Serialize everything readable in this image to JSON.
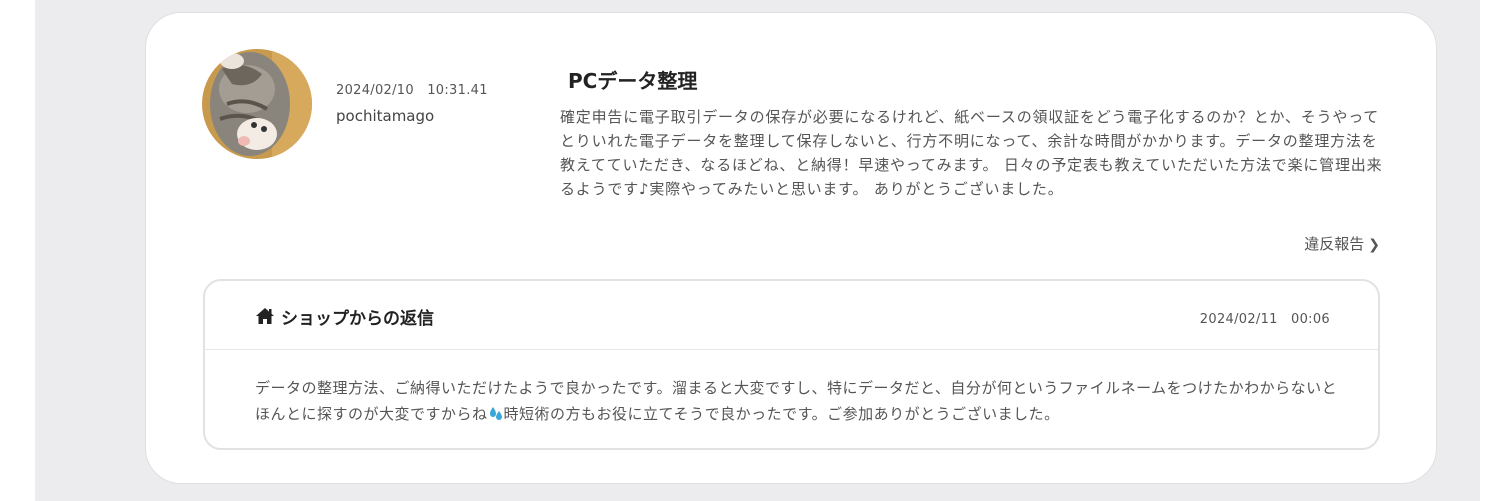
{
  "review": {
    "date": "2024/02/10　10:31.41",
    "username": "pochitamago",
    "avatar_icon": "cat-photo-avatar",
    "title": "PCデータ整理",
    "body": "確定申告に電子取引データの保存が必要になるけれど、紙ベースの領収証をどう電子化するのか？とか、そうやってとりいれた電子データを整理して保存しないと、行方不明になって、余計な時間がかかります。データの整理方法を教えてていただき、なるほどね、と納得！早速やってみます。 日々の予定表も教えていただいた方法で楽に管理出来るようです♪実際やってみたいと思います。 ありがとうございました。",
    "report_label": "違反報告"
  },
  "reply": {
    "icon": "home-icon",
    "title": "ショップからの返信",
    "date": "2024/02/11　00:06",
    "body_part1": "データの整理方法、ご納得いただけたようで良かったです。溜まると大変ですし、特にデータだと、自分が何というファイルネームをつけたかわからないとほんとに探すのが大変ですからね",
    "body_icon": "sweat-drops-icon",
    "body_part2": "時短術の方もお役に立てそうで良かったです。ご参加ありがとうございました。"
  },
  "colors": {
    "page_background": "#ececee",
    "card_background": "#ffffff",
    "accent_drops": "#3aa7d8"
  }
}
